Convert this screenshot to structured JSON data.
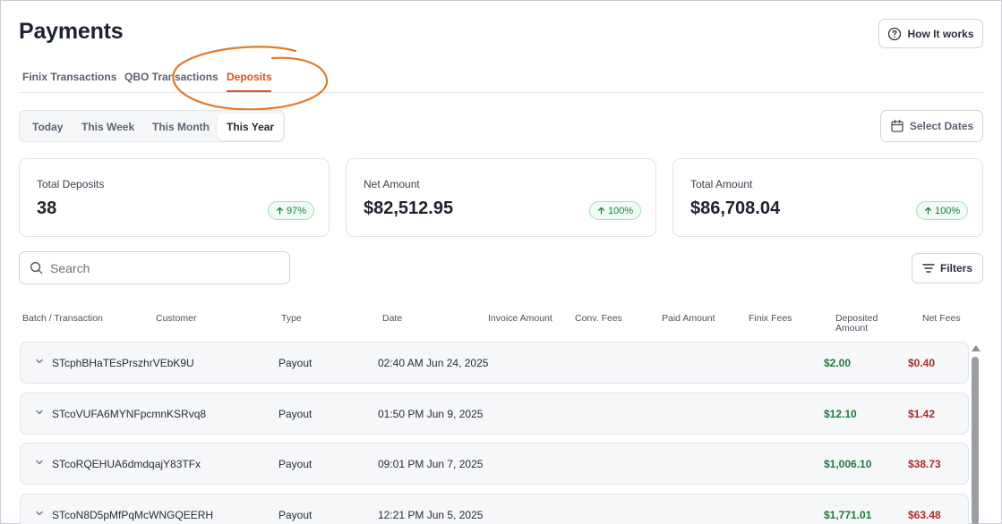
{
  "header": {
    "title": "Payments",
    "how_it_works_label": "How It works"
  },
  "tabs": [
    {
      "label": "Finix Transactions",
      "active": false
    },
    {
      "label": "QBO Transactions",
      "active": false
    },
    {
      "label": "Deposits",
      "active": true
    }
  ],
  "date_range": {
    "options": [
      "Today",
      "This Week",
      "This Month",
      "This Year"
    ],
    "selected": "This Year",
    "select_dates_label": "Select Dates"
  },
  "stats": [
    {
      "label": "Total Deposits",
      "value": "38",
      "change": "97%"
    },
    {
      "label": "Net Amount",
      "value": "$82,512.95",
      "change": "100%"
    },
    {
      "label": "Total Amount",
      "value": "$86,708.04",
      "change": "100%"
    }
  ],
  "search": {
    "placeholder": "Search",
    "value": ""
  },
  "filters_label": "Filters",
  "table": {
    "columns": [
      "Batch / Transaction",
      "Customer",
      "Type",
      "Date",
      "Invoice Amount",
      "Conv. Fees",
      "Paid Amount",
      "Finix Fees",
      "Deposited Amount",
      "Net Fees"
    ],
    "rows": [
      {
        "batch": "STcphBHaTEsPrszhrVEbK9U",
        "type": "Payout",
        "date": "02:40 AM Jun 24, 2025",
        "deposited": "$2.00",
        "net_fees": "$0.40"
      },
      {
        "batch": "STcoVUFA6MYNFpcmnKSRvq8",
        "type": "Payout",
        "date": "01:50 PM Jun 9, 2025",
        "deposited": "$12.10",
        "net_fees": "$1.42"
      },
      {
        "batch": "STcoRQEHUA6dmdqajY83TFx",
        "type": "Payout",
        "date": "09:01 PM Jun 7, 2025",
        "deposited": "$1,006.10",
        "net_fees": "$38.73"
      },
      {
        "batch": "STcoN8D5pMfPqMcWNGQEERH",
        "type": "Payout",
        "date": "12:21 PM Jun 5, 2025",
        "deposited": "$1,771.01",
        "net_fees": "$63.48"
      }
    ]
  },
  "colors": {
    "accent": "#d9531e",
    "deposit_green": "#1d7a3e",
    "fee_red": "#b02a2a",
    "badge_green": "#1f7a44"
  }
}
